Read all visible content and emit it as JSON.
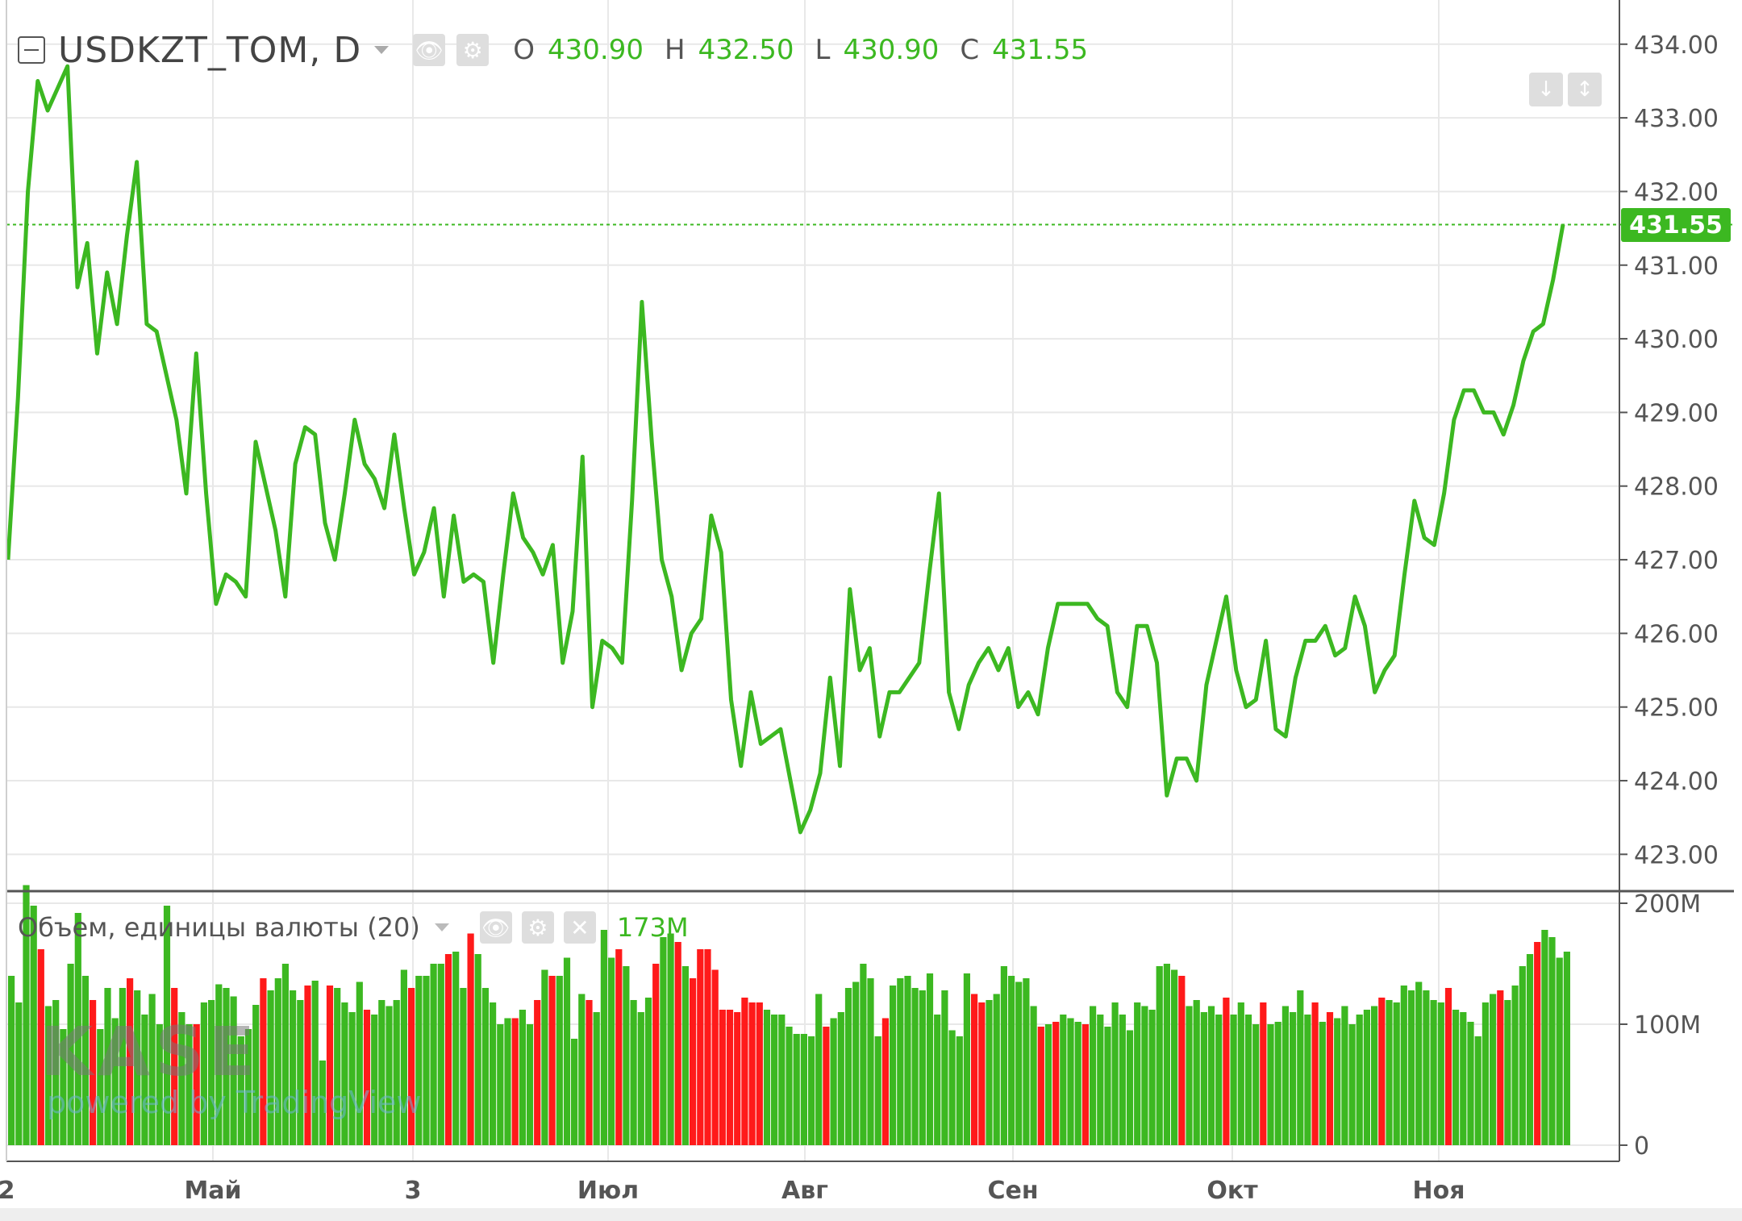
{
  "symbol": "USDKZT_TOM, D",
  "ohlc": {
    "open_label": "O",
    "open": "430.90",
    "high_label": "H",
    "high": "432.50",
    "low_label": "L",
    "low": "430.90",
    "close_label": "C",
    "close": "431.55"
  },
  "current_price_tag": "431.55",
  "volume_indicator": {
    "label": "Объем, единицы валюты (20)",
    "value": "173M"
  },
  "watermark": {
    "logo": "KASE",
    "powered_by": "powered by TradingView"
  },
  "colors": {
    "line": "#3cb821",
    "up_volume": "#3cb821",
    "down_volume": "#ff1a1a",
    "grid": "#e8e8e8",
    "axis_text": "#555555"
  },
  "icons": {
    "eye": "eye-icon",
    "gear": "gear-icon",
    "close": "close-icon",
    "scale_down": "arrow-down-icon",
    "scale_fit": "arrows-vertical-icon"
  },
  "chart_data": [
    {
      "type": "line",
      "title": "USDKZT_TOM, D",
      "x_tick_labels": [
        "2",
        "Май",
        "3",
        "Июл",
        "Авг",
        "Сен",
        "Окт",
        "Ноя"
      ],
      "y_tick_labels": [
        "423.00",
        "424.00",
        "425.00",
        "426.00",
        "427.00",
        "428.00",
        "429.00",
        "430.00",
        "431.00",
        "432.00",
        "433.00",
        "434.00"
      ],
      "ylim": [
        422.5,
        434.6
      ],
      "last_price_line": 431.55,
      "grid": true,
      "values": [
        427.0,
        429.2,
        432.0,
        433.5,
        433.1,
        433.4,
        433.7,
        430.7,
        431.3,
        429.8,
        430.9,
        430.2,
        431.4,
        432.4,
        430.2,
        430.1,
        429.5,
        428.9,
        427.9,
        429.8,
        427.9,
        426.4,
        426.8,
        426.7,
        426.5,
        428.6,
        428.0,
        427.4,
        426.5,
        428.3,
        428.8,
        428.7,
        427.5,
        427.0,
        427.9,
        428.9,
        428.3,
        428.1,
        427.7,
        428.7,
        427.7,
        426.8,
        427.1,
        427.7,
        426.5,
        427.6,
        426.7,
        426.8,
        426.7,
        425.6,
        426.8,
        427.9,
        427.3,
        427.1,
        426.8,
        427.2,
        425.6,
        426.3,
        428.4,
        425.0,
        425.9,
        425.8,
        425.6,
        427.8,
        430.5,
        428.6,
        427.0,
        426.5,
        425.5,
        426.0,
        426.2,
        427.6,
        427.1,
        425.1,
        424.2,
        425.2,
        424.5,
        424.6,
        424.7,
        424.0,
        423.3,
        423.6,
        424.1,
        425.4,
        424.2,
        426.6,
        425.5,
        425.8,
        424.6,
        425.2,
        425.2,
        425.4,
        425.6,
        426.8,
        427.9,
        425.2,
        424.7,
        425.3,
        425.6,
        425.8,
        425.5,
        425.8,
        425.0,
        425.2,
        424.9,
        425.8,
        426.4,
        426.4,
        426.4,
        426.4,
        426.2,
        426.1,
        425.2,
        425.0,
        426.1,
        426.1,
        425.6,
        423.8,
        424.3,
        424.3,
        424.0,
        425.3,
        425.9,
        426.5,
        425.5,
        425.0,
        425.1,
        425.9,
        424.7,
        424.6,
        425.4,
        425.9,
        425.9,
        426.1,
        425.7,
        425.8,
        426.5,
        426.1,
        425.2,
        425.5,
        425.7,
        426.8,
        427.8,
        427.3,
        427.2,
        427.9,
        428.9,
        429.3,
        429.3,
        429.0,
        429.0,
        428.7,
        429.1,
        429.7,
        430.1,
        430.2,
        430.8,
        431.55
      ]
    },
    {
      "type": "bar",
      "title": "Объем, единицы валюты (20)",
      "y_tick_labels": [
        "0",
        "100M",
        "200M"
      ],
      "ylim": [
        0,
        210
      ],
      "unit": "M",
      "values": [
        140,
        118,
        215,
        198,
        162,
        115,
        120,
        96,
        150,
        192,
        140,
        120,
        96,
        130,
        105,
        130,
        138,
        128,
        108,
        125,
        100,
        198,
        130,
        110,
        100,
        100,
        118,
        120,
        133,
        130,
        123,
        90,
        96,
        116,
        138,
        128,
        138,
        150,
        128,
        120,
        132,
        136,
        70,
        132,
        130,
        118,
        110,
        135,
        112,
        108,
        120,
        115,
        120,
        145,
        130,
        140,
        140,
        150,
        150,
        158,
        160,
        130,
        175,
        158,
        130,
        118,
        100,
        105,
        105,
        112,
        100,
        120,
        145,
        140,
        140,
        155,
        88,
        125,
        120,
        110,
        178,
        155,
        162,
        148,
        120,
        110,
        122,
        150,
        172,
        175,
        168,
        148,
        138,
        162,
        162,
        145,
        112,
        112,
        110,
        122,
        118,
        118,
        112,
        108,
        108,
        98,
        92,
        92,
        90,
        125,
        98,
        105,
        110,
        130,
        135,
        150,
        138,
        90,
        105,
        132,
        138,
        140,
        130,
        128,
        142,
        108,
        128,
        95,
        90,
        142,
        125,
        118,
        120,
        125,
        148,
        140,
        135,
        138,
        115,
        98,
        100,
        102,
        108,
        105,
        102,
        100,
        115,
        108,
        98,
        118,
        108,
        95,
        118,
        115,
        112,
        148,
        150,
        145,
        140,
        115,
        120,
        110,
        115,
        108,
        122,
        108,
        118,
        108,
        100,
        118,
        100,
        102,
        115,
        110,
        128,
        108,
        118,
        102,
        110,
        105,
        115,
        100,
        108,
        112,
        115,
        122,
        120,
        118,
        132,
        128,
        135,
        128,
        120,
        118,
        130,
        112,
        110,
        102,
        90,
        118,
        125,
        128,
        120,
        132,
        148,
        158,
        168,
        178,
        172,
        155,
        160
      ],
      "down_days": [
        4,
        11,
        16,
        21,
        24,
        33,
        39,
        42,
        47,
        53,
        58,
        61,
        66,
        69,
        71,
        76,
        80,
        85,
        88,
        90,
        91,
        92,
        93,
        94,
        95,
        96,
        97,
        98,
        99,
        107,
        115,
        127,
        128,
        136,
        138,
        142,
        154,
        160,
        165,
        172,
        174,
        181,
        189,
        196,
        201
      ]
    }
  ]
}
